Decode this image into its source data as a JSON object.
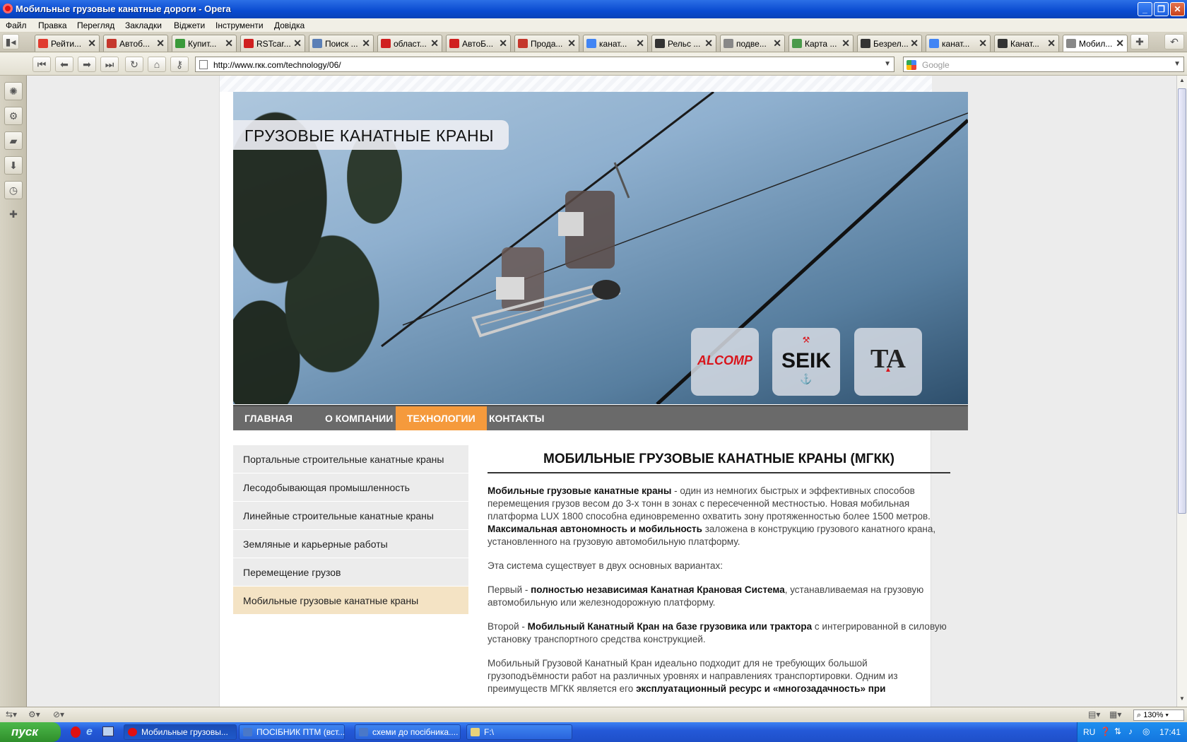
{
  "window": {
    "title": "Мобильные грузовые канатные дороги - Opera",
    "min": "_",
    "max": "❐",
    "close": "✕"
  },
  "menu": [
    "Файл",
    "Правка",
    "Перегляд",
    "Закладки",
    "Віджети",
    "Інструменти",
    "Довідка"
  ],
  "tabs": [
    {
      "label": "Рейти...",
      "color": "#e03b2f"
    },
    {
      "label": "Автоб...",
      "color": "#c5372c"
    },
    {
      "label": "Купит...",
      "color": "#3a9a3a"
    },
    {
      "label": "RSTcar...",
      "color": "#d02020"
    },
    {
      "label": "Поиск ...",
      "color": "#5b7fb6"
    },
    {
      "label": "област...",
      "color": "#d02020"
    },
    {
      "label": "АвтоБ...",
      "color": "#d02020"
    },
    {
      "label": "Прода...",
      "color": "#c5372c"
    },
    {
      "label": "канат...",
      "color": "#4285f4"
    },
    {
      "label": "Рельс ...",
      "color": "#333333"
    },
    {
      "label": "подве...",
      "color": "#888888"
    },
    {
      "label": "Карта ...",
      "color": "#4a9a4a"
    },
    {
      "label": "Безрел...",
      "color": "#333333"
    },
    {
      "label": "канат...",
      "color": "#4285f4"
    },
    {
      "label": "Канат...",
      "color": "#333333"
    },
    {
      "label": "Мобил...",
      "color": "#888888"
    }
  ],
  "toolbar": {
    "url": "http://www.rкк.com/technology/06/",
    "search_placeholder": "Google"
  },
  "site": {
    "hero_title": "ГРУЗОВЫЕ КАНАТНЫЕ КРАНЫ",
    "logos": [
      "ALCOMP",
      "SEIK",
      "TA"
    ],
    "nav": [
      "ГЛАВНАЯ",
      "О КОМПАНИИ",
      "ТЕХНОЛОГИИ",
      "КОНТАКТЫ"
    ],
    "sidebar": [
      "Портальные строительные канатные краны",
      "Лесодобывающая промышленность",
      "Линейные строительные канатные краны",
      "Земляные и карьерные работы",
      "Перемещение грузов",
      "Мобильные грузовые канатные краны"
    ],
    "heading": "МОБИЛЬНЫЕ ГРУЗОВЫЕ КАНАТНЫЕ КРАНЫ (МГКК)",
    "p1_b1": "Мобильные грузовые канатные краны",
    "p1_t1": " - один из немногих быстрых и эффективных способов перемещения грузов весом до 3-х тонн в зонах с пересеченной местностью. Новая мобильная платформа LUX 1800 способна единовременно охватить зону протяженностью более 1500 метров. ",
    "p1_b2": "Максимальная автономность и мобильность",
    "p1_t2": " заложена в конструкцию грузового канатного крана, установленного на грузовую автомобильную платформу.",
    "p2": "Эта система существует в двух основных вариантах:",
    "p3_t1": " Первый - ",
    "p3_b1": "полностью независимая Канатная Крановая Система",
    "p3_t2": ", устанавливаемая на грузовую  автомобильную или железнодорожную платформу.",
    "p4_t1": " Второй -  ",
    "p4_b1": "Мобильный Канатный Кран на базе грузовика или трактора",
    "p4_t2": " с интегрированной в силовую установку транспортного средства конструкцией.",
    "p5_t1": "Мобильный Грузовой Канатный Кран идеально подходит для не требующих большой грузоподъёмности работ на различных уровнях и направлениях транспортировки. Одним из преимуществ МГКК является его ",
    "p5_b1": "эксплуатационный ресурс и «многозадачность» при"
  },
  "status": {
    "zoom": "130%"
  },
  "taskbar": {
    "start": "пуск",
    "tasks": [
      "Мобильные грузовы...",
      "ПОСІБНИК ПТМ (вст...",
      "схеми до посібника....",
      "F:\\"
    ],
    "lang": "RU",
    "time": "17:41"
  }
}
